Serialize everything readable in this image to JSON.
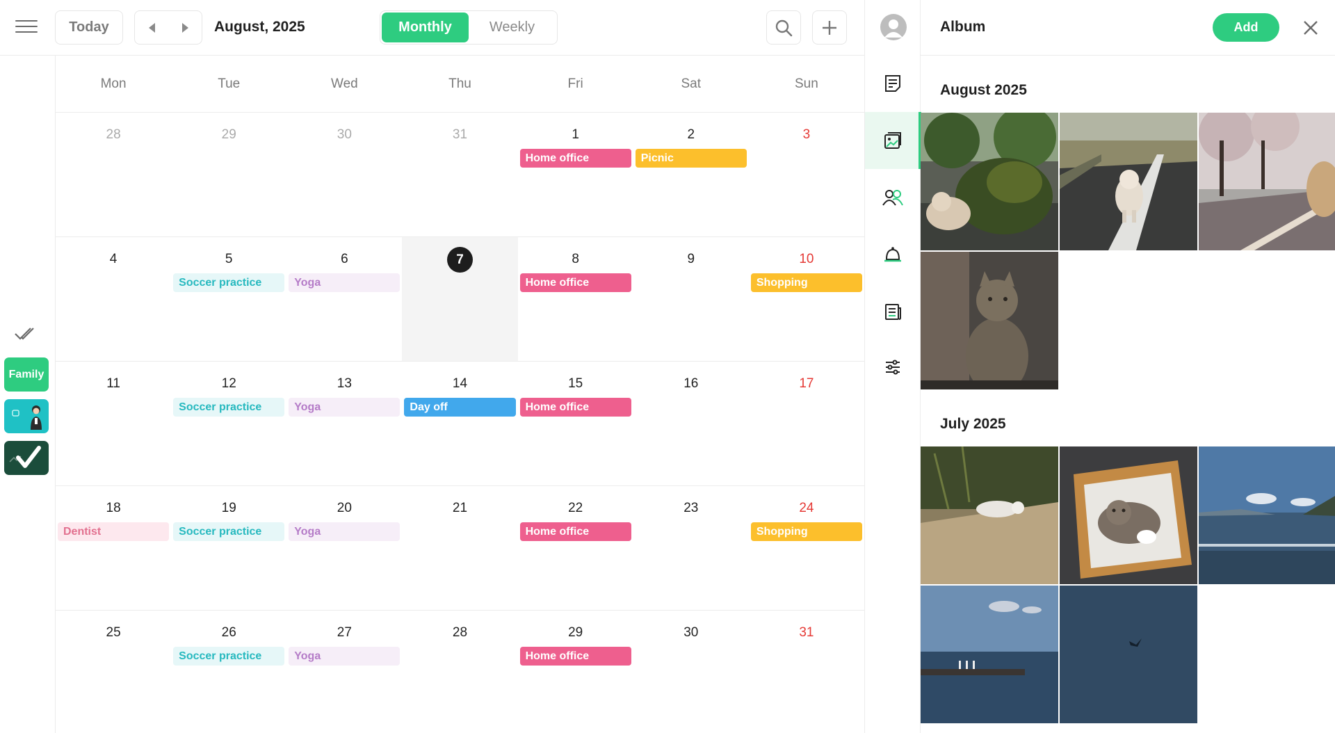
{
  "toolbar": {
    "today_label": "Today",
    "month_title": "August, 2025",
    "view_monthly": "Monthly",
    "view_weekly": "Weekly"
  },
  "left_rail": {
    "calendars": [
      {
        "label": "Family",
        "color": "#2ecc80"
      },
      {
        "label": "",
        "color": "#1fc1c5"
      },
      {
        "label": "",
        "color": "#1b4d3b"
      }
    ]
  },
  "calendar": {
    "weekdays": [
      "Mon",
      "Tue",
      "Wed",
      "Thu",
      "Fri",
      "Sat",
      "Sun"
    ],
    "weeks": [
      [
        {
          "n": "28",
          "other": true
        },
        {
          "n": "29",
          "other": true
        },
        {
          "n": "30",
          "other": true
        },
        {
          "n": "31",
          "other": true
        },
        {
          "n": "1",
          "event": {
            "label": "Home office",
            "style": "homeoffice"
          }
        },
        {
          "n": "2",
          "event": {
            "label": "Picnic",
            "style": "yellow"
          }
        },
        {
          "n": "3",
          "sun": true
        }
      ],
      [
        {
          "n": "4"
        },
        {
          "n": "5",
          "event": {
            "label": "Soccer practice",
            "style": "soccer"
          }
        },
        {
          "n": "6",
          "event": {
            "label": "Yoga",
            "style": "yoga"
          }
        },
        {
          "n": "7",
          "today": true
        },
        {
          "n": "8",
          "event": {
            "label": "Home office",
            "style": "homeoffice"
          }
        },
        {
          "n": "9"
        },
        {
          "n": "10",
          "sun": true,
          "event": {
            "label": "Shopping",
            "style": "yellow"
          }
        }
      ],
      [
        {
          "n": "11"
        },
        {
          "n": "12",
          "event": {
            "label": "Soccer practice",
            "style": "soccer"
          }
        },
        {
          "n": "13",
          "event": {
            "label": "Yoga",
            "style": "yoga"
          }
        },
        {
          "n": "14",
          "event": {
            "label": "Day off",
            "style": "dayoff"
          }
        },
        {
          "n": "15",
          "event": {
            "label": "Home office",
            "style": "homeoffice"
          }
        },
        {
          "n": "16"
        },
        {
          "n": "17",
          "sun": true
        }
      ],
      [
        {
          "n": "18",
          "event": {
            "label": "Dentist",
            "style": "dentist"
          }
        },
        {
          "n": "19",
          "event": {
            "label": "Soccer practice",
            "style": "soccer"
          }
        },
        {
          "n": "20",
          "event": {
            "label": "Yoga",
            "style": "yoga"
          }
        },
        {
          "n": "21"
        },
        {
          "n": "22",
          "event": {
            "label": "Home office",
            "style": "homeoffice"
          }
        },
        {
          "n": "23"
        },
        {
          "n": "24",
          "sun": true,
          "event": {
            "label": "Shopping",
            "style": "yellow"
          }
        }
      ],
      [
        {
          "n": "25"
        },
        {
          "n": "26",
          "event": {
            "label": "Soccer practice",
            "style": "soccer"
          }
        },
        {
          "n": "27",
          "event": {
            "label": "Yoga",
            "style": "yoga"
          }
        },
        {
          "n": "28"
        },
        {
          "n": "29",
          "event": {
            "label": "Home office",
            "style": "homeoffice"
          }
        },
        {
          "n": "30"
        },
        {
          "n": "31",
          "sun": true
        }
      ]
    ],
    "event_styles": {
      "homeoffice": {
        "bg": "#ee5f8e",
        "fg": "#ffffff"
      },
      "yellow": {
        "bg": "#fcbf2c",
        "fg": "#ffffff"
      },
      "soccer": {
        "bg": "#e6f7f8",
        "fg": "#27b9bf"
      },
      "yoga": {
        "bg": "#f6eef8",
        "fg": "#b57cc8"
      },
      "dayoff": {
        "bg": "#41a8ec",
        "fg": "#ffffff"
      },
      "dentist": {
        "bg": "#fde8ee",
        "fg": "#e2708f"
      }
    }
  },
  "icon_rail": {
    "items": [
      "notes-icon",
      "album-icon",
      "people-icon",
      "bell-icon",
      "news-icon",
      "settings-sliders-icon"
    ],
    "active": "album-icon"
  },
  "album": {
    "title": "Album",
    "add_label": "Add",
    "sections": [
      {
        "label": "August 2025",
        "photos": [
          {
            "name": "dog-bush-photo"
          },
          {
            "name": "dog-road-photo"
          },
          {
            "name": "cherry-trees-dog-photo"
          },
          {
            "name": "cat-sitting-photo"
          }
        ]
      },
      {
        "label": "July 2025",
        "photos": [
          {
            "name": "cat-grass-photo"
          },
          {
            "name": "cat-basket-photo"
          },
          {
            "name": "sea-coast-photo"
          },
          {
            "name": "pier-sea-photo"
          },
          {
            "name": "bird-sky-photo"
          }
        ]
      }
    ]
  },
  "colors": {
    "accent": "#2ecc80",
    "sunday": "#e53935",
    "today_circle": "#1d1d1d"
  }
}
